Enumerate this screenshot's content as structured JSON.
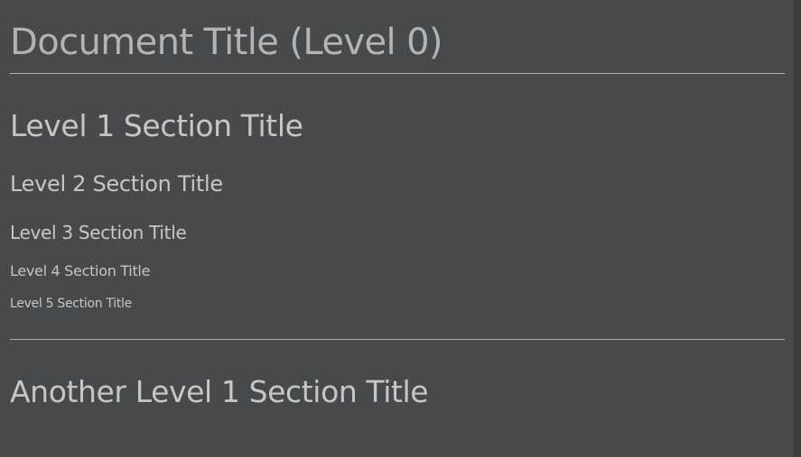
{
  "document": {
    "title": "Document Title (Level 0)",
    "sections": [
      {
        "level": 1,
        "title": "Level 1 Section Title"
      },
      {
        "level": 2,
        "title": "Level 2 Section Title"
      },
      {
        "level": 3,
        "title": "Level 3 Section Title"
      },
      {
        "level": 4,
        "title": "Level 4 Section Title"
      },
      {
        "level": 5,
        "title": "Level 5 Section Title"
      },
      {
        "level": 1,
        "title": "Another Level 1 Section Title"
      }
    ]
  },
  "colors": {
    "background": "#474a4c",
    "text": "#c6c6c6",
    "title_text": "#b3b3b3",
    "rule": "#b0b0b0"
  }
}
